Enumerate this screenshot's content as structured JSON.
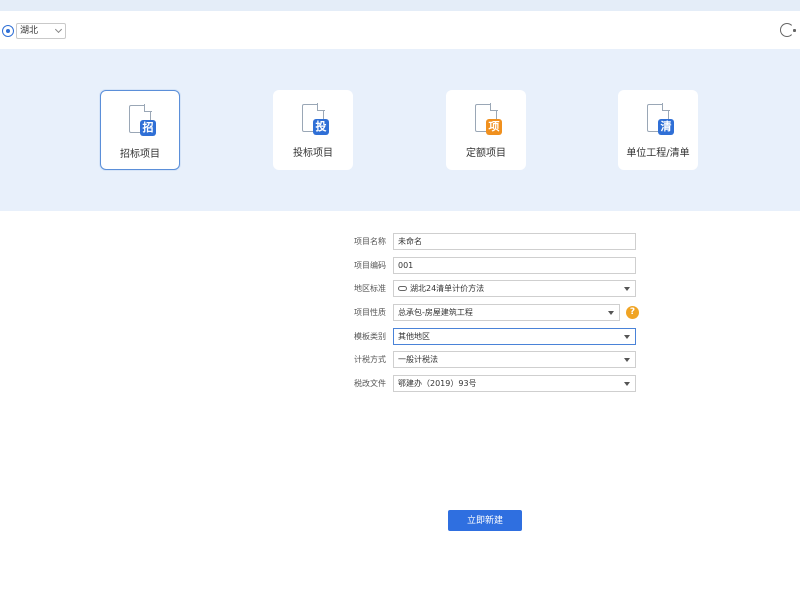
{
  "toolbar": {
    "region_value": "湖北",
    "location_icon": "location-pin-icon",
    "help_icon": "headset-support-icon"
  },
  "project_types": [
    {
      "label": "招标项目",
      "badge": "招",
      "badge_color": "#2f6fd6",
      "selected": true
    },
    {
      "label": "投标项目",
      "badge": "投",
      "badge_color": "#2f6fd6",
      "selected": false
    },
    {
      "label": "定额项目",
      "badge": "项",
      "badge_color": "#f0901e",
      "selected": false
    },
    {
      "label": "单位工程/清单",
      "badge": "清",
      "badge_color": "#2f6fd6",
      "selected": false
    }
  ],
  "form": {
    "project_name": {
      "label": "项目名称",
      "value": "未命名"
    },
    "project_code": {
      "label": "项目编码",
      "value": "001"
    },
    "region_standard": {
      "label": "地区标准",
      "value": "湖北24清单计价方法"
    },
    "project_nature": {
      "label": "项目性质",
      "value": "总承包-房屋建筑工程"
    },
    "template_type": {
      "label": "模板类别",
      "value": "其他地区"
    },
    "tax_method": {
      "label": "计税方式",
      "value": "一般计税法"
    },
    "tax_document": {
      "label": "税改文件",
      "value": "鄂建办（2019）93号"
    }
  },
  "actions": {
    "create_label": "立即新建"
  },
  "colors": {
    "accent": "#2f6fe0",
    "banner_bg": "#e8f0fb",
    "warning": "#f0a424"
  }
}
